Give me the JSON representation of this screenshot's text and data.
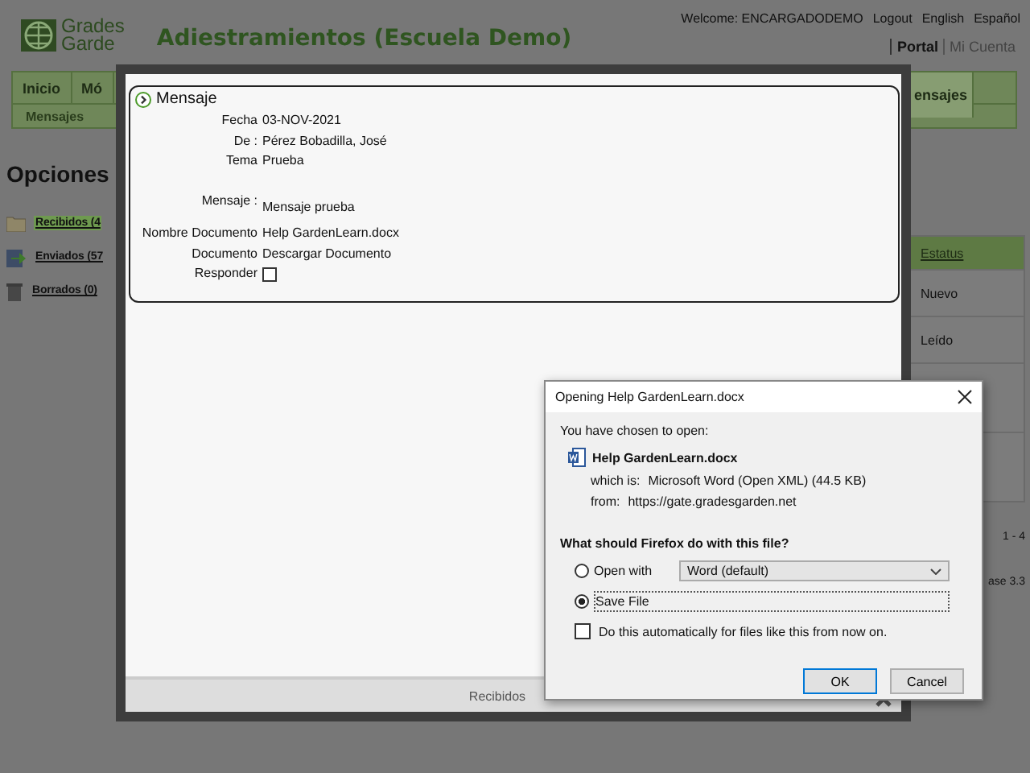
{
  "header": {
    "logo": {
      "line_1": "Grades",
      "line_2": "Garde"
    },
    "title": "Adiestramientos (Escuela Demo)",
    "user_links": [
      "Welcome: ENCARGADODEMO",
      "Logout",
      "English",
      "Español"
    ],
    "account_links": [
      {
        "label": "Portal",
        "selected": true
      },
      {
        "label": "Mi Cuenta",
        "selected": false
      }
    ]
  },
  "nav": {
    "tabs": [
      {
        "label": "Inicio",
        "selected": false
      },
      {
        "label": "Mó",
        "selected": false
      },
      {
        "label": "ensajes",
        "selected": true
      }
    ],
    "subnav": "Mensajes"
  },
  "sidebar": {
    "title": "Opciones",
    "folders": [
      {
        "kind": "inbox",
        "label": "Recibidos (4",
        "selected": true
      },
      {
        "kind": "sent",
        "label": "Enviados (57",
        "selected": false
      },
      {
        "kind": "trash",
        "label": "Borrados (0)",
        "selected": false
      }
    ]
  },
  "table": {
    "column": "Estatus",
    "rows": [
      "Nuevo",
      "Leído"
    ],
    "pager": "1 - 4",
    "footer_note": "ase 3.3"
  },
  "modal": {
    "legend": "Mensaje",
    "fields": [
      {
        "kind": "text",
        "label": "Fecha",
        "value": "03-NOV-2021"
      },
      {
        "kind": "text",
        "label": "De :",
        "value": "Pérez Bobadilla, José"
      },
      {
        "kind": "text",
        "label": "Tema",
        "value": "Prueba"
      },
      {
        "kind": "message",
        "label": "Mensaje :",
        "value": "Mensaje prueba"
      },
      {
        "kind": "text",
        "label": "Nombre Documento",
        "value": "Help GardenLearn.docx"
      },
      {
        "kind": "link",
        "label": "Documento",
        "value": "Descargar Documento"
      },
      {
        "kind": "checkbox",
        "label": "Responder",
        "checked": false
      }
    ],
    "footer": "Recibidos"
  },
  "dialog": {
    "title": "Opening Help GardenLearn.docx",
    "intro": "You have chosen to open:",
    "file_name": "Help GardenLearn.docx",
    "type_label": "which is:",
    "type_value": "Microsoft Word (Open XML) (44.5 KB)",
    "from_label": "from:",
    "from_value": "https://gate.gradesgarden.net",
    "question": "What should Firefox do with this file?",
    "options": [
      {
        "kind": "open",
        "label": "Open with",
        "selected": false,
        "app": "Word (default)"
      },
      {
        "kind": "save",
        "label": "Save File",
        "selected": true
      }
    ],
    "remember": {
      "label": "Do this automatically for files like this from now on.",
      "checked": false
    },
    "buttons": [
      {
        "label": "OK",
        "default": true
      },
      {
        "label": "Cancel",
        "default": false
      }
    ]
  }
}
